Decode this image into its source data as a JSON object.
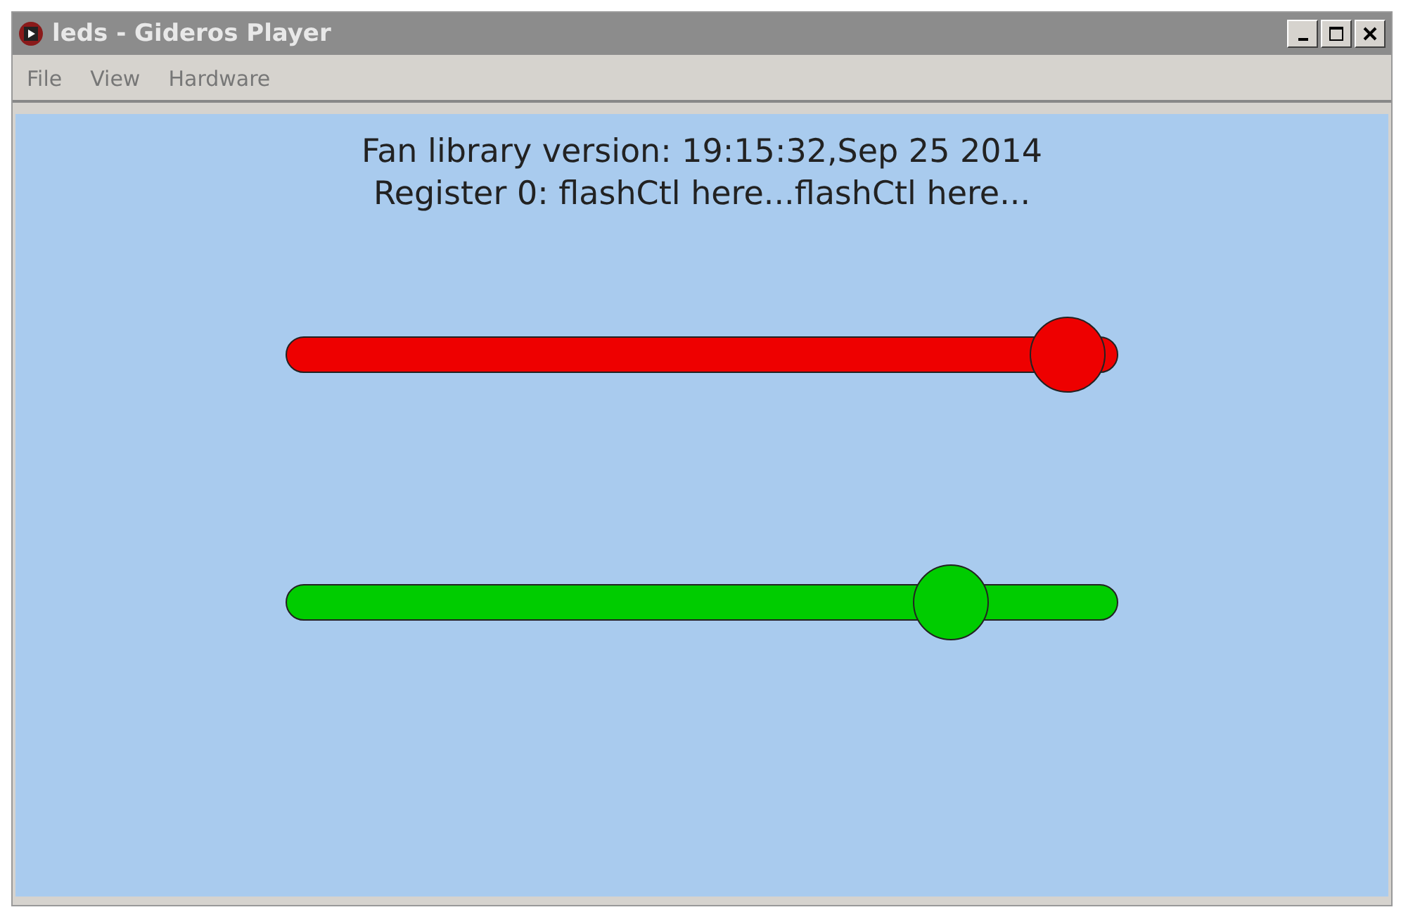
{
  "window": {
    "title": "leds - Gideros Player"
  },
  "menu": [
    "File",
    "View",
    "Hardware"
  ],
  "lines": [
    "Fan library version: 19:15:32,Sep 25 2014",
    "Register 0: flashCtl here...flashCtl here..."
  ],
  "sliders": [
    {
      "color": "#ee0000",
      "level": 0.94
    },
    {
      "color": "#00cc00",
      "level": 0.8
    }
  ]
}
